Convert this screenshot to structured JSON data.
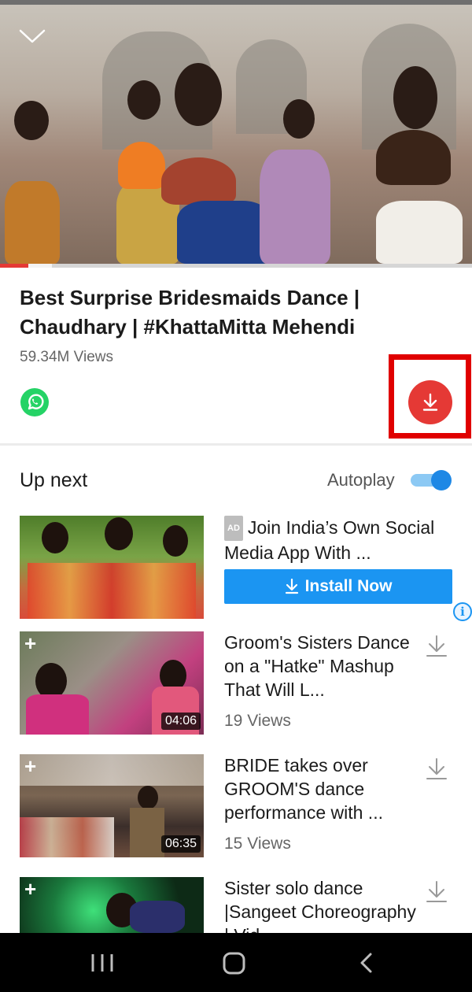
{
  "video": {
    "title": "Best Surprise Bridesmaids Dance | Chaudhary | #KhattaMitta Mehendi",
    "views": "59.34M Views",
    "progress_fraction": 0.06,
    "buffer_fraction": 0.11
  },
  "colors": {
    "accent_red": "#e53935",
    "highlight_red": "#e00000",
    "install_blue": "#1b95f2",
    "whatsapp_green": "#25d366"
  },
  "up_next": {
    "heading": "Up next",
    "autoplay_label": "Autoplay",
    "autoplay_on": true
  },
  "ad": {
    "badge": "AD",
    "title": "Join India’s Own Social Media App With ...",
    "install_label": "Install Now",
    "info_glyph": "i"
  },
  "items": [
    {
      "title": "Groom's Sisters Dance on a \"Hatke\" Mashup That Will L...",
      "views": "19 Views",
      "duration": "04:06"
    },
    {
      "title": "BRIDE takes over GROOM'S dance performance with ...",
      "views": "15 Views",
      "duration": "06:35"
    },
    {
      "title": "Sister solo dance |Sangeet Choreography | Vid...",
      "views": "",
      "duration": ""
    }
  ],
  "icons": {
    "collapse": "chevron-down-icon",
    "share": "whatsapp-icon",
    "download": "download-icon",
    "add": "plus-icon",
    "info": "info-icon"
  }
}
